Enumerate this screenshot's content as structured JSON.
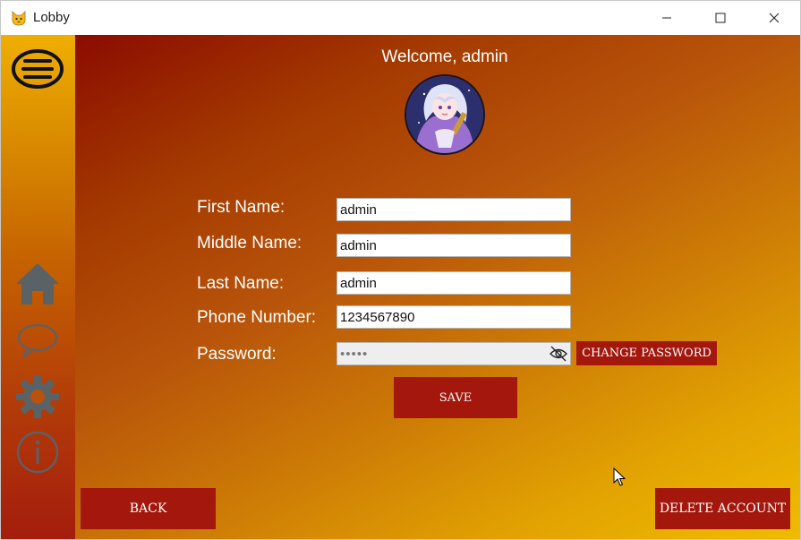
{
  "window": {
    "title": "Lobby",
    "app_icon": "cat-face-icon"
  },
  "titlebar_controls": [
    "minimize-icon",
    "maximize-icon",
    "close-icon"
  ],
  "sidebar": {
    "menu_icon": "hamburger-menu-icon",
    "items": [
      {
        "icon": "home-icon"
      },
      {
        "icon": "chat-bubble-icon"
      },
      {
        "icon": "gear-icon"
      },
      {
        "icon": "info-icon"
      }
    ]
  },
  "header": {
    "welcome": "Welcome, admin"
  },
  "form": {
    "first_name_label": "First Name:",
    "first_name_value": "admin",
    "middle_name_label": "Middle Name:",
    "middle_name_value": "admin",
    "last_name_label": "Last Name:",
    "last_name_value": "admin",
    "phone_label": "Phone Number:",
    "phone_value": "1234567890",
    "password_label": "Password:",
    "password_value": "•••••",
    "change_password_label": "CHANGE PASSWORD",
    "save_label": "SAVE"
  },
  "footer": {
    "back_label": "BACK",
    "delete_label": "DELETE ACCOUNT"
  },
  "colors": {
    "button_red": "#a3170c",
    "sidebar_top": "#efae00",
    "sidebar_bottom": "#a41d0d",
    "content_dark": "#8b0c00",
    "content_light": "#efbc00",
    "icon_gray": "#5b6266"
  }
}
